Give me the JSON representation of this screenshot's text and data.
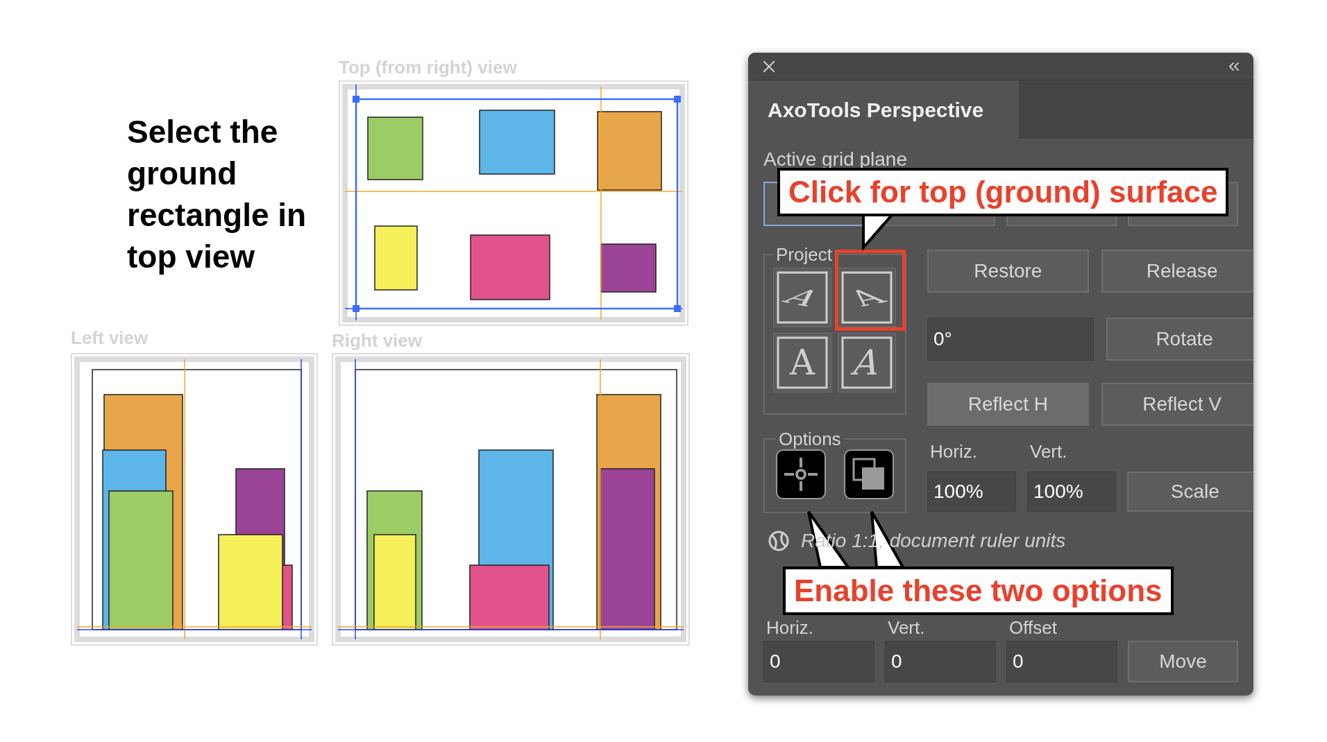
{
  "instruction": "Select the ground rectangle in top view",
  "views": [
    {
      "kind": "top",
      "title": "Top (from right) view"
    },
    {
      "kind": "left",
      "title": "Left view"
    },
    {
      "kind": "right",
      "title": "Right view"
    }
  ],
  "panel": {
    "tab": {
      "label": "AxoTools Perspective",
      "selected": true
    },
    "grid_plane": {
      "label": "Active grid plane",
      "buttons": [
        {
          "selected": true
        },
        {
          "selected": false
        },
        {
          "selected": false
        },
        {
          "selected": false
        }
      ]
    },
    "project": {
      "label": "Project",
      "buttons": [
        {
          "kind": "top",
          "glyph": "A"
        },
        {
          "kind": "top-right",
          "glyph": "A"
        },
        {
          "kind": "front",
          "glyph": "A"
        },
        {
          "kind": "side",
          "glyph": "A"
        }
      ]
    },
    "restore": "Restore",
    "release": "Release",
    "angle": "0°",
    "rotate": "Rotate",
    "reflect": [
      {
        "label": "Reflect H",
        "pressed": true
      },
      {
        "label": "Reflect V",
        "pressed": false
      }
    ],
    "options": {
      "label": "Options",
      "toggles": [
        {
          "kind": "center",
          "on": true
        },
        {
          "kind": "copy",
          "on": true
        }
      ]
    },
    "scale": {
      "labels": [
        "Horiz.",
        "Vert."
      ],
      "values": [
        "100%",
        "100%"
      ],
      "button": "Scale"
    },
    "ratio_note": "Ratio 1:1, document ruler units",
    "move": {
      "labels": [
        "Horiz.",
        "Vert.",
        "Offset"
      ],
      "values": [
        "0",
        "0",
        "0"
      ],
      "button": "Move"
    }
  },
  "callouts": [
    {
      "kind": "top",
      "text": "Click for top (ground) surface"
    },
    {
      "kind": "bottom",
      "text": "Enable these two options"
    }
  ]
}
